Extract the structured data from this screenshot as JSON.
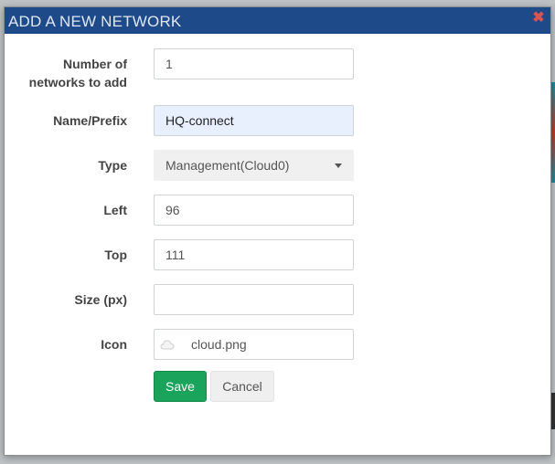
{
  "modal": {
    "title": "ADD A NEW NETWORK",
    "close_icon": "close-icon",
    "fields": {
      "count": {
        "label_line1": "Number of",
        "label_line2": "networks to add",
        "value": "1"
      },
      "name": {
        "label": "Name/Prefix",
        "value": "HQ-connect"
      },
      "type": {
        "label": "Type",
        "value": "Management(Cloud0)"
      },
      "left": {
        "label": "Left",
        "value": "96"
      },
      "top": {
        "label": "Top",
        "value": "111"
      },
      "size": {
        "label": "Size (px)",
        "value": ""
      },
      "icon": {
        "label": "Icon",
        "value": "cloud.png",
        "icon_name": "cloud-icon"
      }
    },
    "buttons": {
      "save": "Save",
      "cancel": "Cancel"
    }
  },
  "colors": {
    "header_bg": "#1e4a8a",
    "save_bg": "#1aa35a",
    "close": "#d9534f"
  }
}
